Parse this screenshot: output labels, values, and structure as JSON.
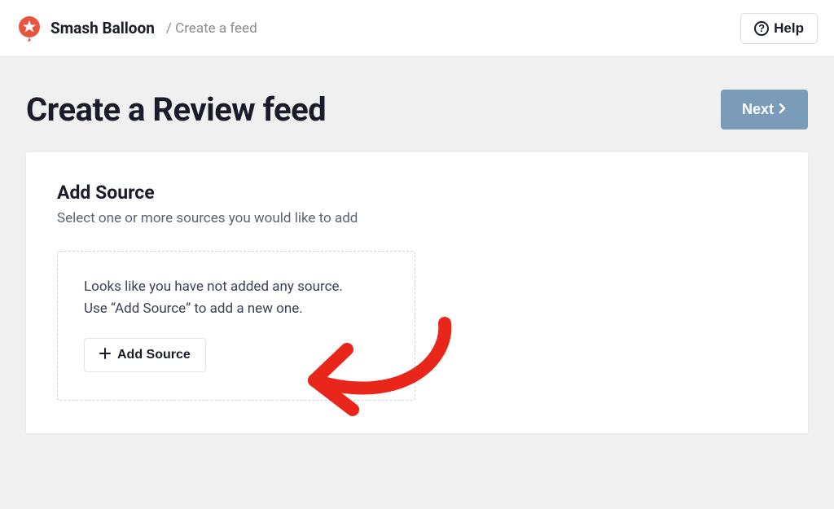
{
  "header": {
    "brand": "Smash Balloon",
    "breadcrumb_separator": "/",
    "breadcrumb": "Create a feed",
    "help_label": "Help"
  },
  "page": {
    "title": "Create a Review feed",
    "next_label": "Next"
  },
  "card": {
    "title": "Add Source",
    "subtitle": "Select one or more sources you would like to add",
    "empty_line1": "Looks like you have not added any source.",
    "empty_line2": "Use “Add Source” to add a new one.",
    "add_button_label": "Add Source"
  },
  "colors": {
    "accent": "#e8553e",
    "next_button": "#7a9cb8",
    "annotation_arrow": "#e8261a"
  }
}
